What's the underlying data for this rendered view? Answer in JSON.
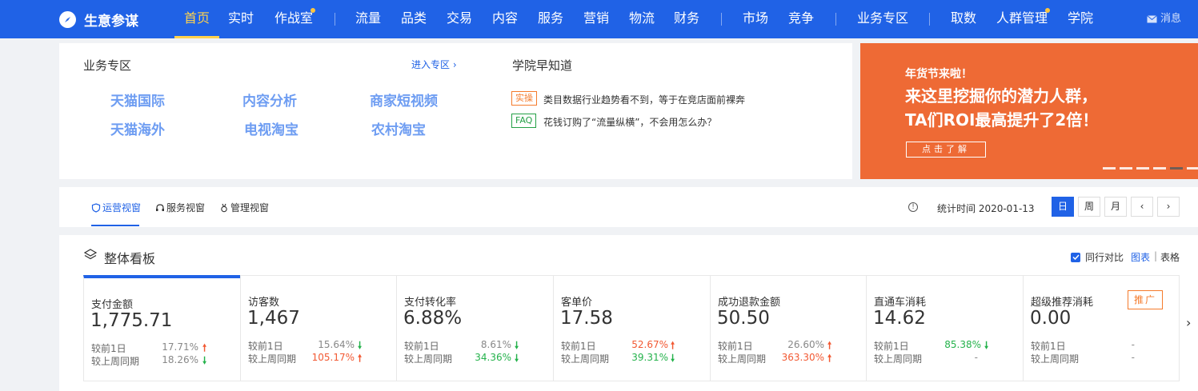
{
  "app": {
    "name": "生意参谋"
  },
  "nav": {
    "items": [
      "首页",
      "实时",
      "作战室",
      "流量",
      "品类",
      "交易",
      "内容",
      "服务",
      "营销",
      "物流",
      "财务",
      "市场",
      "竞争",
      "业务专区",
      "取数",
      "人群管理",
      "学院"
    ],
    "message": "消息"
  },
  "business": {
    "title": "业务专区",
    "enter": "进入专区 ›",
    "items": [
      "天猫国际",
      "内容分析",
      "商家短视频",
      "天猫海外",
      "电视淘宝",
      "农村淘宝"
    ]
  },
  "academy": {
    "title": "学院早知道",
    "news": [
      {
        "tag": "实操",
        "text": "类目数据行业趋势看不到，等于在竞店面前裸奔"
      },
      {
        "tag": "FAQ",
        "text": "花钱订购了“流量纵横”，不会用怎么办？"
      }
    ]
  },
  "banner": {
    "line1": "年货节来啦！",
    "line2": "来这里挖掘你的潜力人群，",
    "line3": "TA们ROI最高提升了2倍！",
    "button": "点击了解",
    "slide_count": 6,
    "active_slide": 5
  },
  "tabs": [
    "运营视窗",
    "服务视窗",
    "管理视窗"
  ],
  "stat": {
    "label": "统计时间 2020-01-13",
    "periods": [
      "日",
      "周",
      "月"
    ],
    "prev": "‹",
    "next": "›"
  },
  "board": {
    "title": "整体看板",
    "compare": "同行对比",
    "view_chart": "图表",
    "view_sep": "|",
    "view_table": "表格",
    "promo": "推广",
    "row1_label": "较前1日",
    "row2_label": "较上周同期",
    "metrics": [
      {
        "label": "支付金额",
        "value": "1,775.71",
        "d1": "17.71%",
        "d1_dir": "up",
        "w1": "18.26%",
        "w1_dir": "down",
        "d1_color": "gray",
        "w1_color": "gray"
      },
      {
        "label": "访客数",
        "value": "1,467",
        "d1": "15.64%",
        "d1_dir": "down",
        "w1": "105.17%",
        "w1_dir": "up",
        "d1_color": "gray",
        "w1_color": "red"
      },
      {
        "label": "支付转化率",
        "value": "6.88%",
        "d1": "8.61%",
        "d1_dir": "down",
        "w1": "34.36%",
        "w1_dir": "down",
        "d1_color": "gray",
        "w1_color": "green"
      },
      {
        "label": "客单价",
        "value": "17.58",
        "d1": "52.67%",
        "d1_dir": "up",
        "w1": "39.31%",
        "w1_dir": "down",
        "d1_color": "red",
        "w1_color": "green"
      },
      {
        "label": "成功退款金额",
        "value": "50.50",
        "d1": "26.60%",
        "d1_dir": "up",
        "w1": "363.30%",
        "w1_dir": "up",
        "d1_color": "gray",
        "w1_color": "red"
      },
      {
        "label": "直通车消耗",
        "value": "14.62",
        "d1": "85.38%",
        "d1_dir": "down",
        "w1": "-",
        "w1_dir": "",
        "d1_color": "green",
        "w1_color": "gray"
      },
      {
        "label": "超级推荐消耗",
        "value": "0.00",
        "d1": "-",
        "d1_dir": "",
        "w1": "-",
        "w1_dir": "",
        "d1_color": "gray",
        "w1_color": "gray"
      }
    ]
  },
  "colors": {
    "primary": "#2062e6",
    "accent": "#ffd24d",
    "up": "#f25933",
    "down": "#24b24b",
    "banner": "#ee6a35"
  }
}
